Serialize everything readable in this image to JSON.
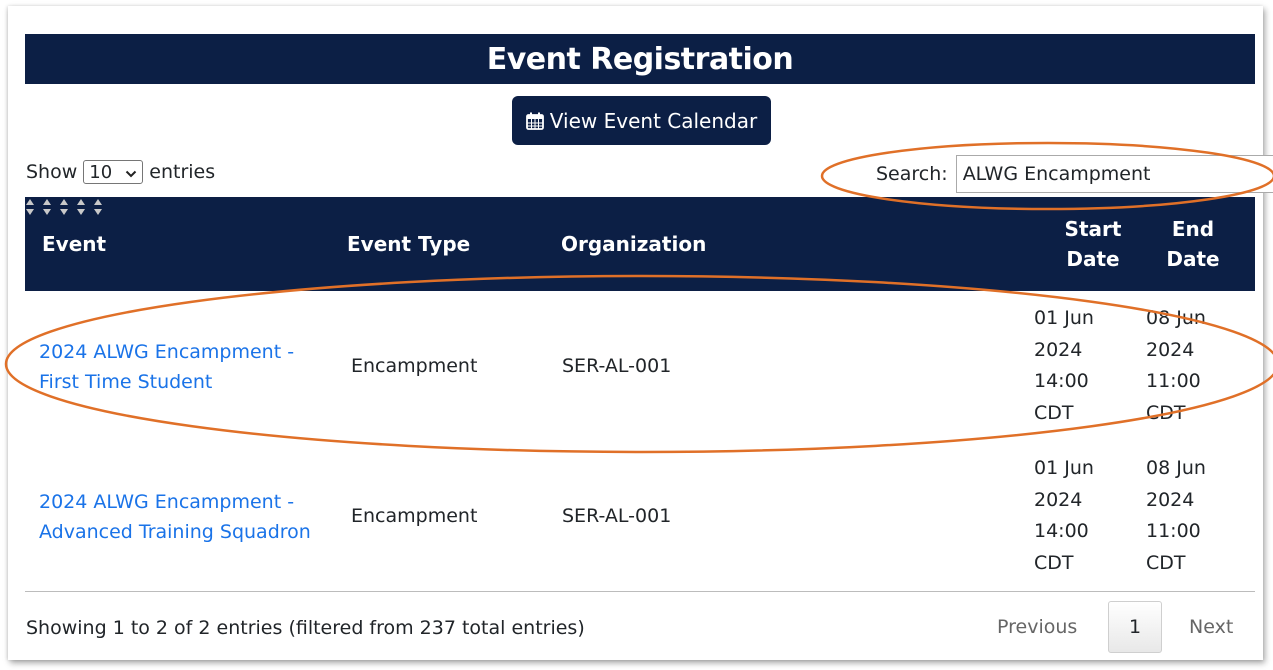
{
  "page": {
    "title": "Event Registration"
  },
  "calendar_button": {
    "label": "View Event Calendar",
    "icon": "calendar-icon"
  },
  "length_control": {
    "prefix": "Show",
    "selected": "10",
    "suffix": "entries"
  },
  "search": {
    "label": "Search:",
    "value": "ALWG Encampment"
  },
  "table": {
    "columns": [
      {
        "label": "Event"
      },
      {
        "label": "Event Type"
      },
      {
        "label": "Organization"
      },
      {
        "label_line1": "Start",
        "label_line2": "Date"
      },
      {
        "label_line1": "End",
        "label_line2": "Date"
      }
    ],
    "rows": [
      {
        "event_line1": "2024 ALWG Encampment -",
        "event_line2": "First Time Student",
        "type": "Encampment",
        "org": "SER-AL-001",
        "start": [
          "01 Jun",
          "2024",
          "14:00",
          "CDT"
        ],
        "end": [
          "08 Jun",
          "2024",
          "11:00",
          "CDT"
        ]
      },
      {
        "event_line1": "2024 ALWG Encampment -",
        "event_line2": "Advanced Training Squadron",
        "type": "Encampment",
        "org": "SER-AL-001",
        "start": [
          "01 Jun",
          "2024",
          "14:00",
          "CDT"
        ],
        "end": [
          "08 Jun",
          "2024",
          "11:00",
          "CDT"
        ]
      }
    ]
  },
  "info": "Showing 1 to 2 of 2 entries (filtered from 237 total entries)",
  "pagination": {
    "previous": "Previous",
    "current": "1",
    "next": "Next"
  },
  "colors": {
    "navy": "#0c1f45",
    "link": "#1a73e8",
    "annotation": "#e07028"
  }
}
